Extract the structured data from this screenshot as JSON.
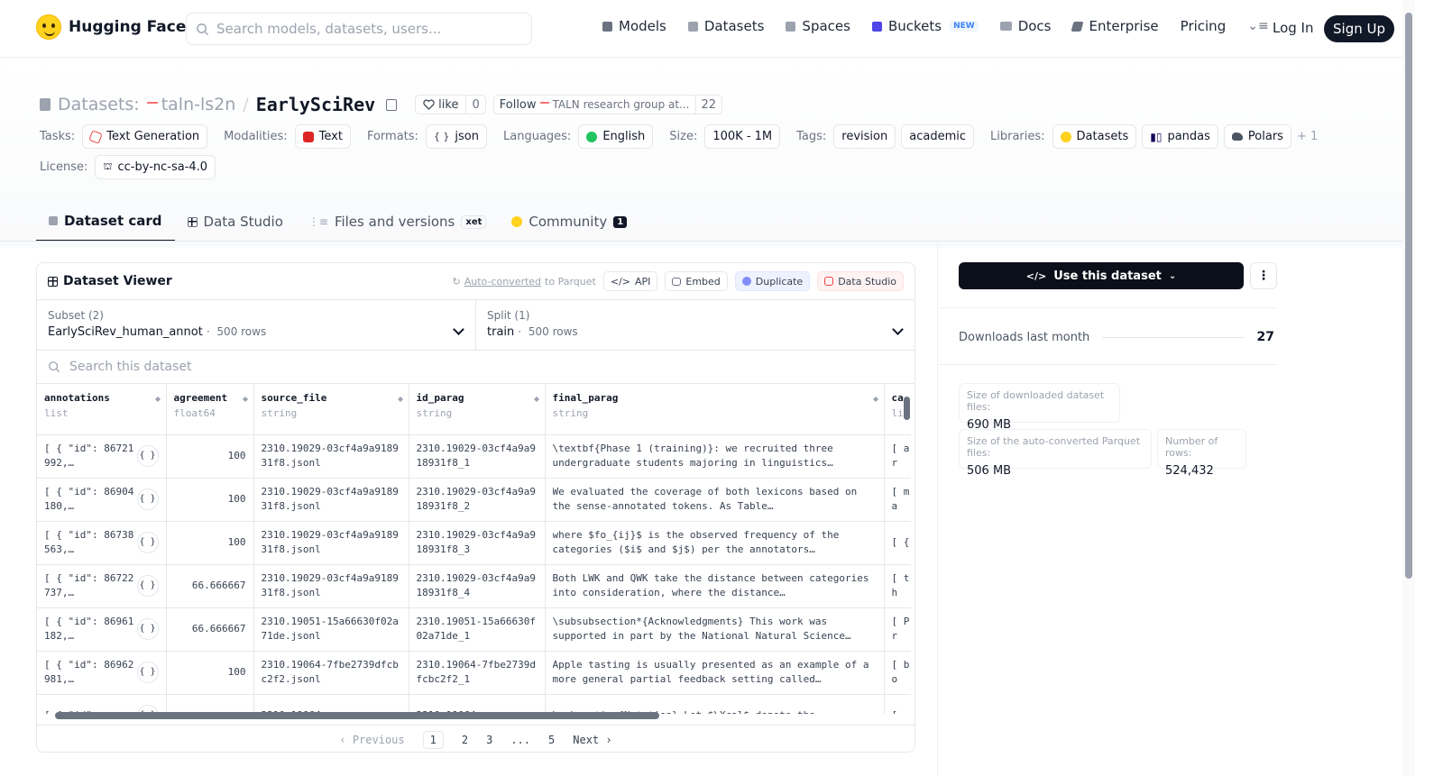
{
  "nav": {
    "brand": "Hugging Face",
    "search_placeholder": "Search models, datasets, users...",
    "links": [
      {
        "label": "Models",
        "icon": "cube-icon"
      },
      {
        "label": "Datasets",
        "icon": "database-icon"
      },
      {
        "label": "Spaces",
        "icon": "grid-icon"
      },
      {
        "label": "Buckets",
        "icon": "bucket-icon"
      },
      {
        "label": "Docs",
        "icon": "book-icon"
      },
      {
        "label": "Enterprise",
        "icon": "enterprise-icon"
      },
      {
        "label": "Pricing"
      }
    ],
    "new_badge": "NEW",
    "login": "Log In",
    "signup": "Sign Up"
  },
  "header": {
    "crumb_label": "Datasets:",
    "org": "taln-ls2n",
    "dataset": "EarlySciRev",
    "like_label": "like",
    "like_count": "0",
    "follow_label": "Follow",
    "follow_org": "TALN research group at...",
    "follow_count": "22"
  },
  "meta": {
    "tasks_label": "Tasks:",
    "task": "Text Generation",
    "modalities_label": "Modalities:",
    "modality": "Text",
    "formats_label": "Formats:",
    "format": "json",
    "languages_label": "Languages:",
    "language": "English",
    "size_label": "Size:",
    "size": "100K - 1M",
    "tags_label": "Tags:",
    "tags": [
      "revision",
      "academic"
    ],
    "libraries_label": "Libraries:",
    "libraries": [
      "Datasets",
      "pandas",
      "Polars"
    ],
    "libraries_more": "+ 1",
    "license_label": "License:",
    "license": "cc-by-nc-sa-4.0"
  },
  "tabs": [
    {
      "label": "Dataset card"
    },
    {
      "label": "Data Studio"
    },
    {
      "label": "Files and versions",
      "badge": "xet"
    },
    {
      "label": "Community",
      "badge": "1"
    }
  ],
  "viewer": {
    "title": "Dataset Viewer",
    "auto_converted_link": "Auto-converted",
    "auto_converted_rest": "to Parquet",
    "api": "API",
    "embed": "Embed",
    "duplicate": "Duplicate",
    "data_studio": "Data Studio",
    "subset_label": "Subset (2)",
    "subset_value": "EarlySciRev_human_annot",
    "subset_rows": "500 rows",
    "split_label": "Split (1)",
    "split_value": "train",
    "split_rows": "500 rows",
    "search_placeholder": "Search this dataset",
    "columns": [
      {
        "name": "annotations",
        "type": "list"
      },
      {
        "name": "agreement",
        "type": "float64"
      },
      {
        "name": "source_file",
        "type": "string"
      },
      {
        "name": "id_parag",
        "type": "string"
      },
      {
        "name": "final_parag",
        "type": "string"
      },
      {
        "name": "ca",
        "type": "li"
      }
    ],
    "json_btn": "{ }",
    "rows": [
      {
        "annotations": "[ { \"id\": 86721992,…",
        "agreement": "100",
        "source_file": "2310.19029-03cf4a9a918931f8.jsonl",
        "id_parag": "2310.19029-03cf4a9a918931f8_1",
        "final_parag": "\\textbf{Phase 1 (training)}: we recruited three undergraduate students majoring in linguistics…",
        "ca": "[ ar"
      },
      {
        "annotations": "[ { \"id\": 86904180,…",
        "agreement": "100",
        "source_file": "2310.19029-03cf4a9a918931f8.jsonl",
        "id_parag": "2310.19029-03cf4a9a918931f8_2",
        "final_parag": "We evaluated the coverage of both lexicons based on the sense-annotated tokens. As Table…",
        "ca": "[ ma"
      },
      {
        "annotations": "[ { \"id\": 86738563,…",
        "agreement": "100",
        "source_file": "2310.19029-03cf4a9a918931f8.jsonl",
        "id_parag": "2310.19029-03cf4a9a918931f8_3",
        "final_parag": "where $fo_{ij}$ is the observed frequency of the categories ($i$ and $j$) per the annotators…",
        "ca": "[ {"
      },
      {
        "annotations": "[ { \"id\": 86722737,…",
        "agreement": "66.666667",
        "source_file": "2310.19029-03cf4a9a918931f8.jsonl",
        "id_parag": "2310.19029-03cf4a9a918931f8_4",
        "final_parag": "Both LWK and QWK take the distance between categories into consideration, where the distance…",
        "ca": "[ th"
      },
      {
        "annotations": "[ { \"id\": 86961182,…",
        "agreement": "66.666667",
        "source_file": "2310.19051-15a66630f02a71de.jsonl",
        "id_parag": "2310.19051-15a66630f02a71de_1",
        "final_parag": "\\subsubsection*{Acknowledgments} This work was supported in part by the National Natural Science…",
        "ca": "[ Pr"
      },
      {
        "annotations": "[ { \"id\": 86962981,…",
        "agreement": "100",
        "source_file": "2310.19064-7fbe2739dfcbc2f2.jsonl",
        "id_parag": "2310.19064-7fbe2739dfcbc2f2_1",
        "final_parag": "Apple tasting is usually presented as an example of a more general partial feedback setting called…",
        "ca": "[ bo"
      },
      {
        "annotations": "[ { \"id\":",
        "agreement": "",
        "source_file": "2310.19064-",
        "id_parag": "2310.19064-",
        "final_parag": "\\subsection{Notation} Let $\\Xcal$ denote the",
        "ca": "["
      }
    ],
    "pager": {
      "prev": "‹ Previous",
      "pages": [
        "1",
        "2",
        "3",
        "...",
        "5"
      ],
      "next": "Next ›"
    }
  },
  "sidebar": {
    "use_button": "Use this dataset",
    "kebab": "⋮",
    "downloads_label": "Downloads last month",
    "downloads_value": "27",
    "stats": [
      {
        "label": "Size of downloaded dataset files:",
        "value": "690 MB"
      },
      {
        "label": "Size of the auto-converted Parquet files:",
        "value": "506 MB"
      },
      {
        "label": "Number of rows:",
        "value": "524,432"
      }
    ]
  },
  "colors": {
    "accent": "#111827",
    "brand": "#FFD21E",
    "primary_button": "#0b0f19"
  }
}
